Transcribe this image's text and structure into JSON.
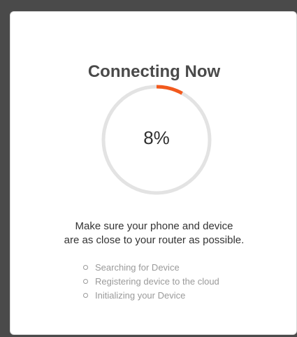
{
  "dialog": {
    "title": "Connecting Now",
    "progress": {
      "label": "8%",
      "value": 0.08,
      "track_color": "#e3e3e3",
      "fill_color": "#f2591d"
    },
    "message_lines": [
      "Make sure your phone and device",
      "are as close to your router as possible."
    ],
    "steps": [
      "Searching for Device",
      "Registering device to the cloud",
      "Initializing your Device"
    ]
  }
}
